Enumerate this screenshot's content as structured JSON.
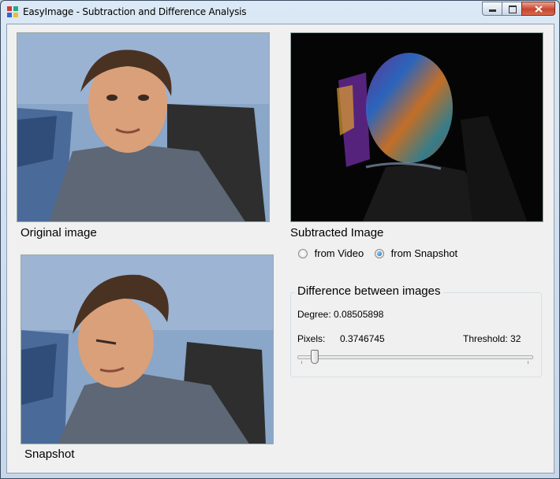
{
  "window": {
    "title": "EasyImage - Subtraction and Difference Analysis"
  },
  "images": {
    "original_label": "Original image",
    "subtracted_label": "Subtracted Image",
    "snapshot_label": "Snapshot"
  },
  "source_options": [
    {
      "label": "from Video",
      "checked": false
    },
    {
      "label": "from Snapshot",
      "checked": true
    }
  ],
  "difference": {
    "group_title": "Difference between images",
    "degree_text": "Degree: 0.08505898",
    "pixels_label": "Pixels:",
    "pixels_value": "0.3746745",
    "threshold_text": "Threshold: 32",
    "threshold_slider_fraction": 0.06
  },
  "colors": {
    "close_button": "#c7452e",
    "window_bg": "#f0f0f0"
  }
}
